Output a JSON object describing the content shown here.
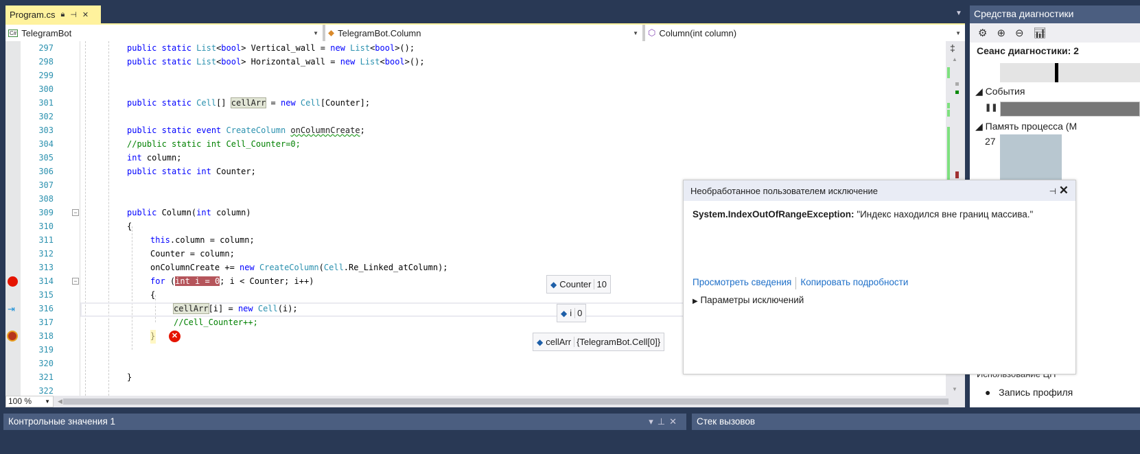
{
  "tab": {
    "title": "Program.cs",
    "lock_icon": "lock-icon",
    "pin_icon": "pin-icon",
    "close_icon": "close-icon"
  },
  "navbar": {
    "project": "TelegramBot",
    "type": "TelegramBot.Column",
    "member": "Column(int column)"
  },
  "editor": {
    "zoom": "100 %",
    "lines": [
      {
        "n": "297",
        "indent": 185,
        "t": [
          [
            "public static ",
            "kw"
          ],
          [
            "List",
            "ty"
          ],
          [
            "<",
            "pl"
          ],
          [
            "bool",
            "kw"
          ],
          [
            "> Vertical_wall = ",
            "pl"
          ],
          [
            "new ",
            "kw"
          ],
          [
            "List",
            "ty"
          ],
          [
            "<",
            "pl"
          ],
          [
            "bool",
            "kw"
          ],
          [
            ">();",
            "pl"
          ]
        ]
      },
      {
        "n": "298",
        "indent": 185,
        "t": [
          [
            "public static ",
            "kw"
          ],
          [
            "List",
            "ty"
          ],
          [
            "<",
            "pl"
          ],
          [
            "bool",
            "kw"
          ],
          [
            "> Horizontal_wall = ",
            "pl"
          ],
          [
            "new ",
            "kw"
          ],
          [
            "List",
            "ty"
          ],
          [
            "<",
            "pl"
          ],
          [
            "bool",
            "kw"
          ],
          [
            ">();",
            "pl"
          ]
        ]
      },
      {
        "n": "299",
        "indent": 185,
        "t": []
      },
      {
        "n": "300",
        "indent": 185,
        "t": []
      },
      {
        "n": "301",
        "indent": 185,
        "t": [
          [
            "public static ",
            "kw"
          ],
          [
            "Cell",
            "ty"
          ],
          [
            "[] ",
            "pl"
          ],
          [
            "cellArr",
            "sel"
          ],
          [
            " = ",
            "pl"
          ],
          [
            "new ",
            "kw"
          ],
          [
            "Cell",
            "ty"
          ],
          [
            "[Counter];",
            "pl"
          ]
        ]
      },
      {
        "n": "302",
        "indent": 185,
        "t": []
      },
      {
        "n": "303",
        "indent": 185,
        "t": [
          [
            "public static event ",
            "kw"
          ],
          [
            "CreateColumn ",
            "ty"
          ],
          [
            "onColumnCreate",
            "sq"
          ],
          [
            ";",
            "pl"
          ]
        ]
      },
      {
        "n": "304",
        "indent": 185,
        "t": [
          [
            "//public static int Cell_Counter=0;",
            "cm"
          ]
        ]
      },
      {
        "n": "305",
        "indent": 185,
        "t": [
          [
            "int ",
            "kw"
          ],
          [
            "column;",
            "pl"
          ]
        ]
      },
      {
        "n": "306",
        "indent": 185,
        "t": [
          [
            "public static int ",
            "kw"
          ],
          [
            "Counter;",
            "pl"
          ]
        ]
      },
      {
        "n": "307",
        "indent": 185,
        "t": []
      },
      {
        "n": "308",
        "indent": 185,
        "t": []
      },
      {
        "n": "309",
        "indent": 185,
        "t": [
          [
            "public ",
            "kw"
          ],
          [
            "Column(",
            "pl"
          ],
          [
            "int ",
            "kw"
          ],
          [
            "column)",
            "pl"
          ]
        ]
      },
      {
        "n": "310",
        "indent": 185,
        "t": [
          [
            "{",
            "pl"
          ]
        ]
      },
      {
        "n": "311",
        "indent": 219,
        "t": [
          [
            "this",
            "kw"
          ],
          [
            ".column = column;",
            "pl"
          ]
        ]
      },
      {
        "n": "312",
        "indent": 219,
        "t": [
          [
            "Counter = column;",
            "pl"
          ]
        ]
      },
      {
        "n": "313",
        "indent": 219,
        "t": [
          [
            "onColumnCreate += ",
            "pl"
          ],
          [
            "new ",
            "kw"
          ],
          [
            "CreateColumn",
            "ty"
          ],
          [
            "(",
            "pl"
          ],
          [
            "Cell",
            "ty"
          ],
          [
            ".Re_Linked_atColumn);",
            "pl"
          ]
        ]
      },
      {
        "n": "314",
        "indent": 219,
        "t": [
          [
            "for ",
            "kw"
          ],
          [
            "(",
            "pl"
          ],
          [
            "int i = 0",
            "err"
          ],
          [
            "; i < Counter; i++)",
            "pl"
          ]
        ]
      },
      {
        "n": "315",
        "indent": 219,
        "t": [
          [
            "{",
            "pl"
          ]
        ]
      },
      {
        "n": "316",
        "indent": 253,
        "t": [
          [
            "cellArr",
            "sel"
          ],
          [
            "[i] = ",
            "pl"
          ],
          [
            "new ",
            "kw"
          ],
          [
            "Cell",
            "ty"
          ],
          [
            "(i);",
            "pl"
          ]
        ]
      },
      {
        "n": "317",
        "indent": 253,
        "t": [
          [
            "//Cell_Counter++;",
            "cm"
          ]
        ]
      },
      {
        "n": "318",
        "indent": 219,
        "t": [
          [
            "}",
            "pl"
          ]
        ]
      },
      {
        "n": "319",
        "indent": 219,
        "t": []
      },
      {
        "n": "320",
        "indent": 219,
        "t": []
      },
      {
        "n": "321",
        "indent": 185,
        "t": [
          [
            "}",
            "pl"
          ]
        ]
      },
      {
        "n": "322",
        "indent": 185,
        "t": []
      }
    ],
    "datatips": [
      {
        "name": "Counter",
        "value": "10"
      },
      {
        "name": "i",
        "value": "0"
      },
      {
        "name": "cellArr",
        "value": "{TelegramBot.Cell[0]}"
      }
    ]
  },
  "exception": {
    "title": "Необработанное пользователем исключение",
    "type": "System.IndexOutOfRangeException:",
    "message": "\"Индекс находился вне границ массива.\"",
    "link_details": "Просмотреть сведения",
    "link_copy": "Копировать подробности",
    "params": "Параметры исключений"
  },
  "diagnostics": {
    "title": "Средства диагностики",
    "session": "Сеанс диагностики: 2",
    "events": "События",
    "memory": "Память процесса (М",
    "memory_value": "27",
    "cpu": "Использование ЦП",
    "record": "Запись профиля"
  },
  "bottom": {
    "watch": "Контрольные значения 1",
    "callstack": "Стек вызовов"
  },
  "colors": {
    "tab_active": "#fff29d",
    "frame": "#293955",
    "breakpoint": "#e51400",
    "error_highlight": "#b5555b"
  }
}
